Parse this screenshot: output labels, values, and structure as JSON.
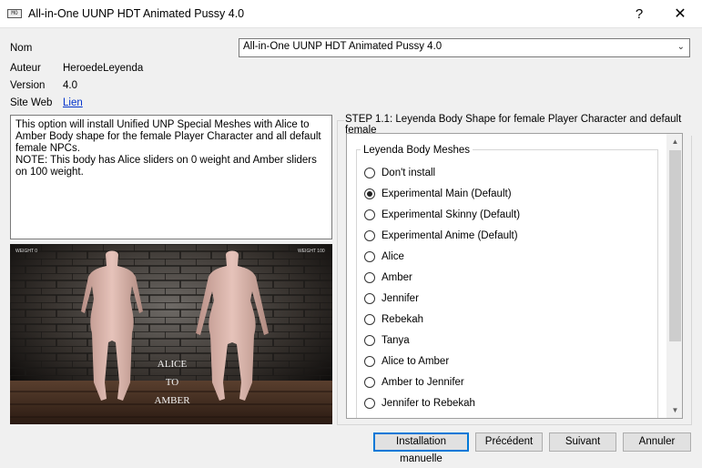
{
  "window": {
    "title": "All-in-One UUNP HDT Animated Pussy 4.0",
    "help_glyph": "?",
    "close_glyph": "✕",
    "app_icon": "installer-app-icon"
  },
  "info": {
    "name_label": "Nom",
    "name_value": "All-in-One UUNP HDT Animated Pussy 4.0",
    "author_label": "Auteur",
    "author_value": "HeroedeLeyenda",
    "version_label": "Version",
    "version_value": "4.0",
    "website_label": "Site Web",
    "website_link": "Lien"
  },
  "description": "This option will install Unified UNP Special Meshes with Alice to Amber Body shape for the female Player Character and all default female NPCs.\nNOTE: This body has Alice sliders on 0 weight and Amber sliders on 100 weight.",
  "preview": {
    "left_tag": "WEIGHT 0",
    "right_tag": "WEIGHT 100",
    "caption_1": "ALICE",
    "caption_2": "TO",
    "caption_3": "AMBER"
  },
  "step": {
    "title": "STEP 1.1: Leyenda Body Shape for female Player Character and default female",
    "group_title": "Leyenda Body Meshes",
    "options": [
      {
        "label": "Don't install",
        "checked": false
      },
      {
        "label": "Experimental Main (Default)",
        "checked": true
      },
      {
        "label": "Experimental Skinny (Default)",
        "checked": false
      },
      {
        "label": "Experimental Anime (Default)",
        "checked": false
      },
      {
        "label": "Alice",
        "checked": false
      },
      {
        "label": "Amber",
        "checked": false
      },
      {
        "label": "Jennifer",
        "checked": false
      },
      {
        "label": "Rebekah",
        "checked": false
      },
      {
        "label": "Tanya",
        "checked": false
      },
      {
        "label": "Alice to Amber",
        "checked": false
      },
      {
        "label": "Amber to Jennifer",
        "checked": false
      },
      {
        "label": "Jennifer to Rebekah",
        "checked": false
      }
    ]
  },
  "buttons": {
    "manual": "Installation manuelle",
    "previous": "Précédent",
    "next": "Suivant",
    "cancel": "Annuler"
  },
  "colors": {
    "link": "#0033cc",
    "default_button_border": "#0078d7",
    "window_bg": "#f0f0f0"
  }
}
